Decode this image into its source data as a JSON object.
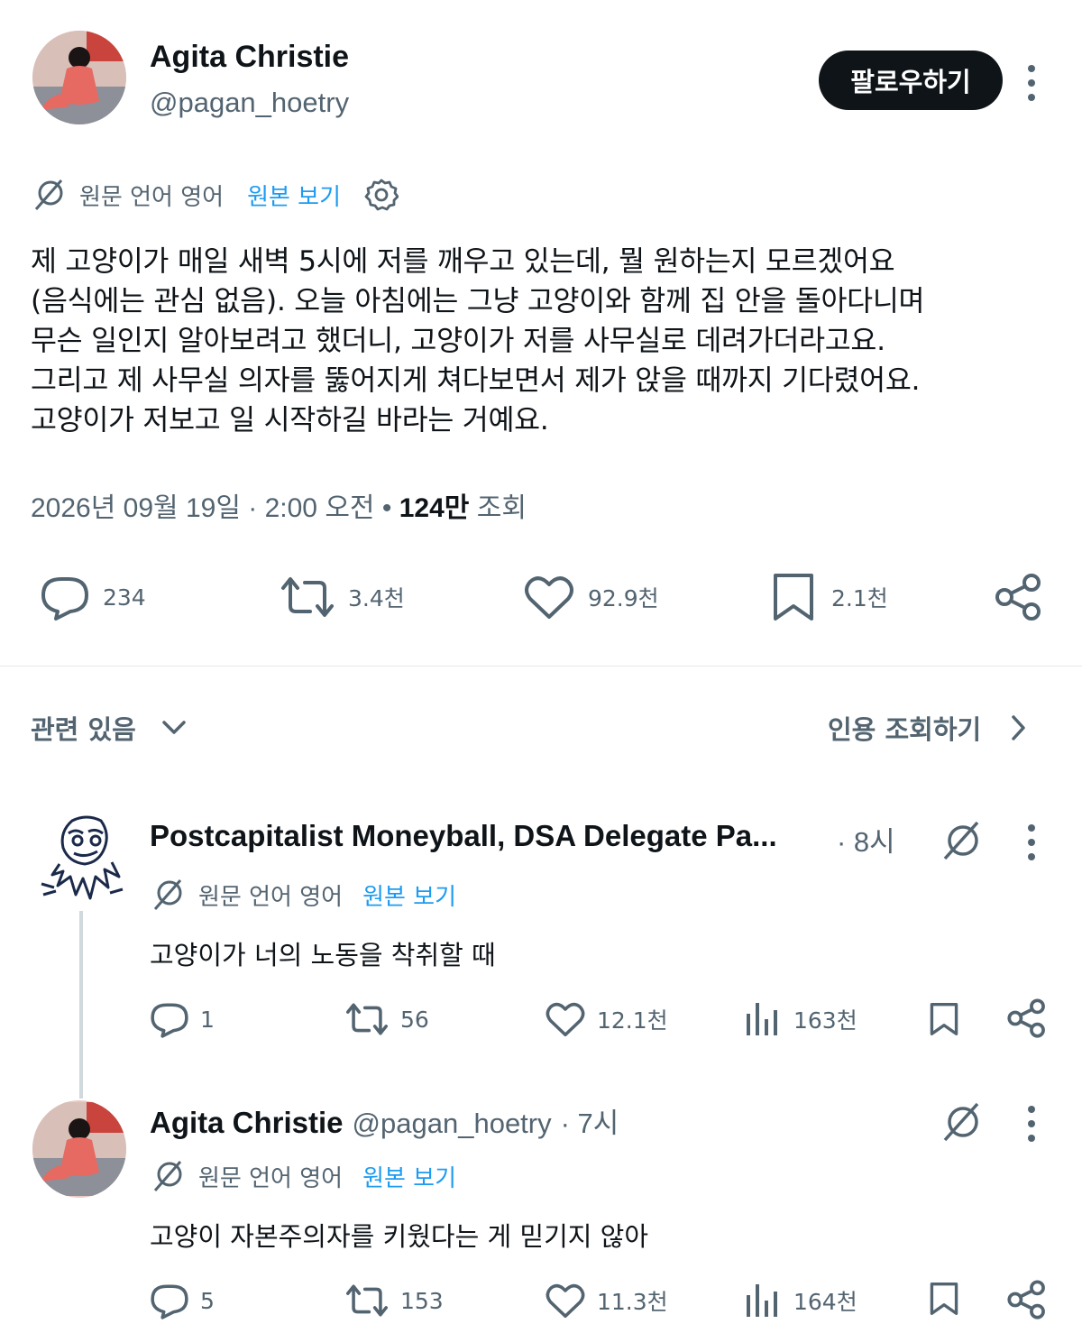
{
  "tweet": {
    "author_name": "Agita Christie",
    "author_handle": "@pagan_hoetry",
    "follow_label": "팔로우하기",
    "translation": {
      "source_label": "원문 언어 영어",
      "view_original": "원본 보기"
    },
    "text_lines": [
      "제 고양이가 매일 새벽 5시에 저를 깨우고 있는데, 뭘 원하는지 모르겠어요",
      "(음식에는 관심 없음). 오늘 아침에는 그냥 고양이와 함께 집 안을 돌아다니며",
      "무슨 일인지 알아보려고 했더니, 고양이가 저를 사무실로 데려가더라고요.",
      "그리고 제 사무실 의자를 뚫어지게 쳐다보면서 제가 앉을 때까지 기다렸어요.",
      "고양이가 저보고 일 시작하길 바라는 거예요."
    ],
    "timestamp": "2026년 09월 19일 · 2:00 오전",
    "views_count": "124만",
    "views_label": "조회",
    "stats": {
      "replies": "234",
      "retweets": "3.4천",
      "likes": "92.9천",
      "bookmarks": "2.1천"
    }
  },
  "related": {
    "label": "관련 있음",
    "quotes_label": "인용 조회하기"
  },
  "replies": [
    {
      "author_name": "Postcapitalist Moneyball, DSA Delegate Pa...",
      "time": "· 8시",
      "translation_source": "원문 언어 영어",
      "view_original": "원본 보기",
      "text": "고양이가 너의 노동을 착취할 때",
      "stats": {
        "replies": "1",
        "retweets": "56",
        "likes": "12.1천",
        "views": "163천"
      }
    },
    {
      "author_name": "Agita Christie",
      "author_handle": "@pagan_hoetry",
      "time": "· 7시",
      "translation_source": "원문 언어 영어",
      "view_original": "원본 보기",
      "text": "고양이 자본주의자를 키웠다는 게 믿기지 않아",
      "stats": {
        "replies": "5",
        "retweets": "153",
        "likes": "11.3천",
        "views": "164천"
      }
    }
  ],
  "colors": {
    "text": "#0f1419",
    "secondary": "#536471",
    "link": "#1d9bf0",
    "divider": "#e6e8ea"
  }
}
